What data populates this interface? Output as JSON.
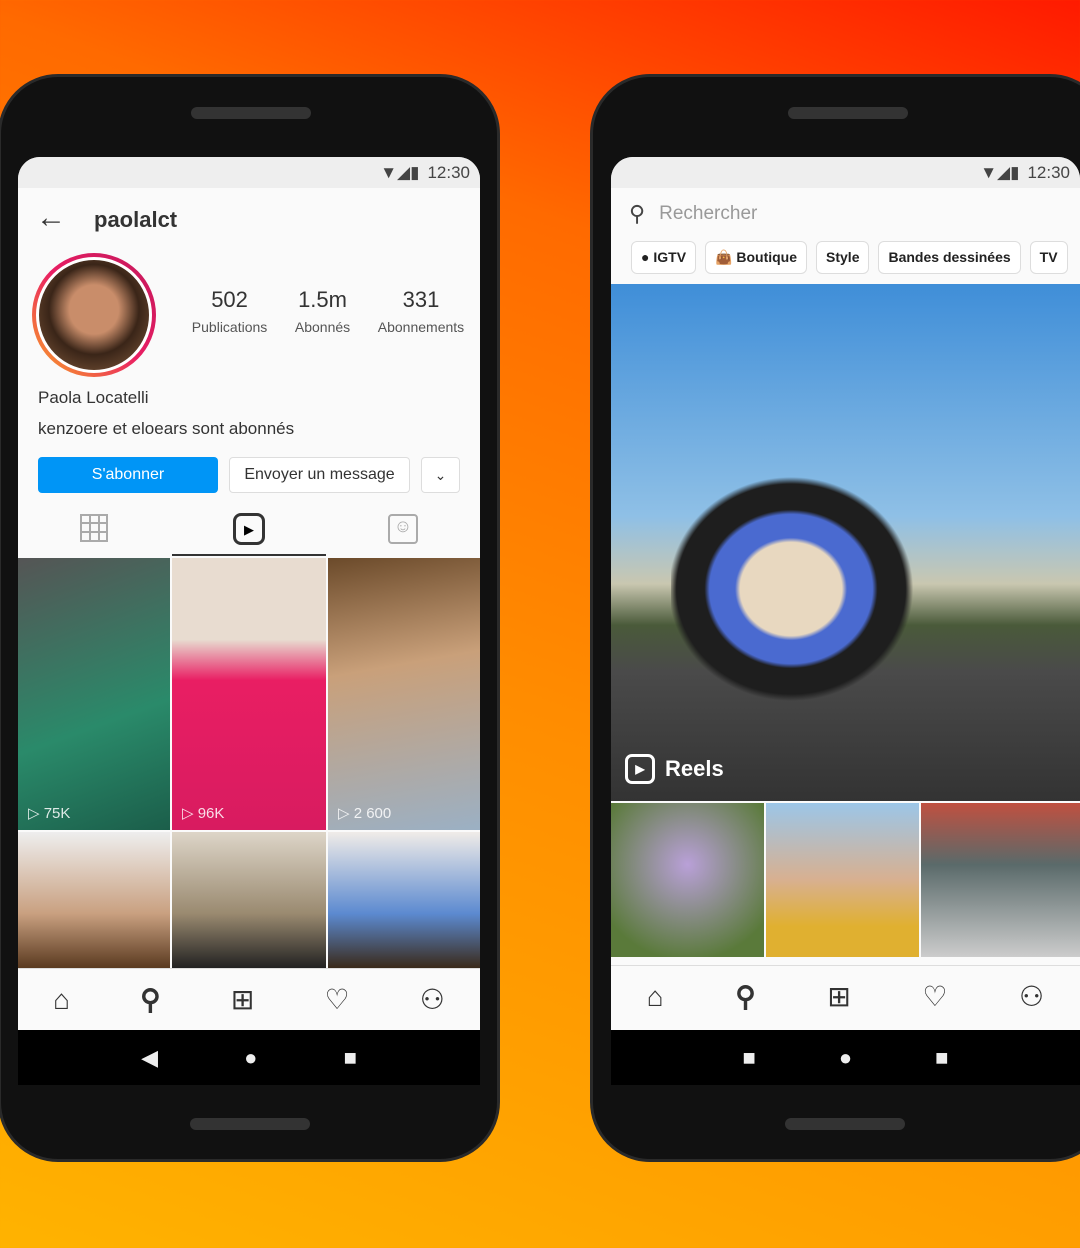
{
  "status": {
    "time": "12:30"
  },
  "profile": {
    "username": "paolalct",
    "posts": "502",
    "posts_label": "Publications",
    "followers": "1.5m",
    "followers_label": "Abonnés",
    "following": "331",
    "following_label": "Abonnements",
    "name": "Paola Locatelli",
    "mutual": "kenzoere et eloears sont abonnés",
    "follow_label": "S'abonner",
    "message_label": "Envoyer un message",
    "reels": [
      {
        "views": "75K"
      },
      {
        "views": "96K"
      },
      {
        "views": "2 600"
      }
    ]
  },
  "explore": {
    "search_placeholder": "Rechercher",
    "chips": [
      "IGTV",
      "Boutique",
      "Style",
      "Bandes dessinées",
      "TV"
    ],
    "reels_label": "Reels"
  },
  "colors": {
    "accent": "#0095f6"
  }
}
